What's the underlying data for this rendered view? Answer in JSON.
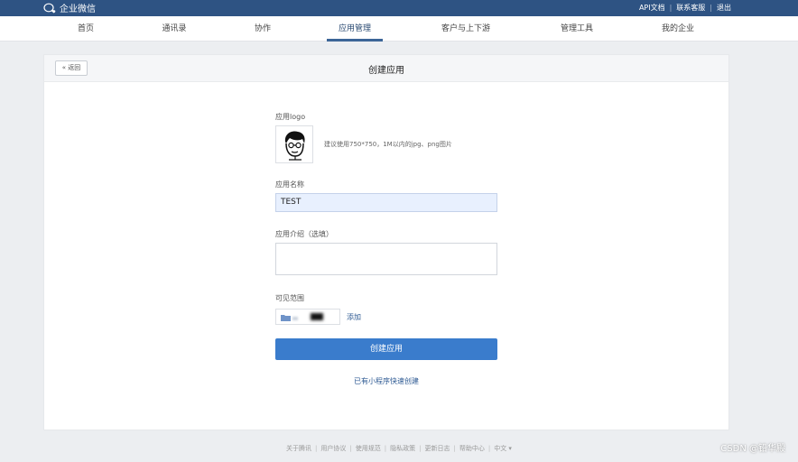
{
  "topbar": {
    "brand": "企业微信",
    "links": [
      "API文档",
      "联系客服",
      "退出"
    ]
  },
  "nav": {
    "items": [
      "首页",
      "通讯录",
      "协作",
      "应用管理",
      "客户与上下游",
      "管理工具",
      "我的企业"
    ],
    "active": "应用管理"
  },
  "card": {
    "back_label": "« 返回",
    "title": "创建应用"
  },
  "form": {
    "logo_label": "应用logo",
    "logo_hint": "建议使用750*750，1M以内的jpg、png图片",
    "name_label": "应用名称",
    "name_value": "TEST",
    "intro_label": "应用介绍（选填）",
    "intro_value": "",
    "scope_label": "可见范围",
    "add_label": "添加",
    "submit_label": "创建应用",
    "mini_program_link": "已有小程序快速创建"
  },
  "footer": {
    "links": [
      "关于腾讯",
      "用户协议",
      "使用规范",
      "隐私政策",
      "更新日志",
      "帮助中心",
      "中文 ▾"
    ]
  },
  "watermark": "CSDN @铅华殿",
  "colors": {
    "topbar": "#2e5383",
    "primary": "#3a7ccc",
    "link": "#2e5a93",
    "nav_active_underline": "#3c6597"
  }
}
